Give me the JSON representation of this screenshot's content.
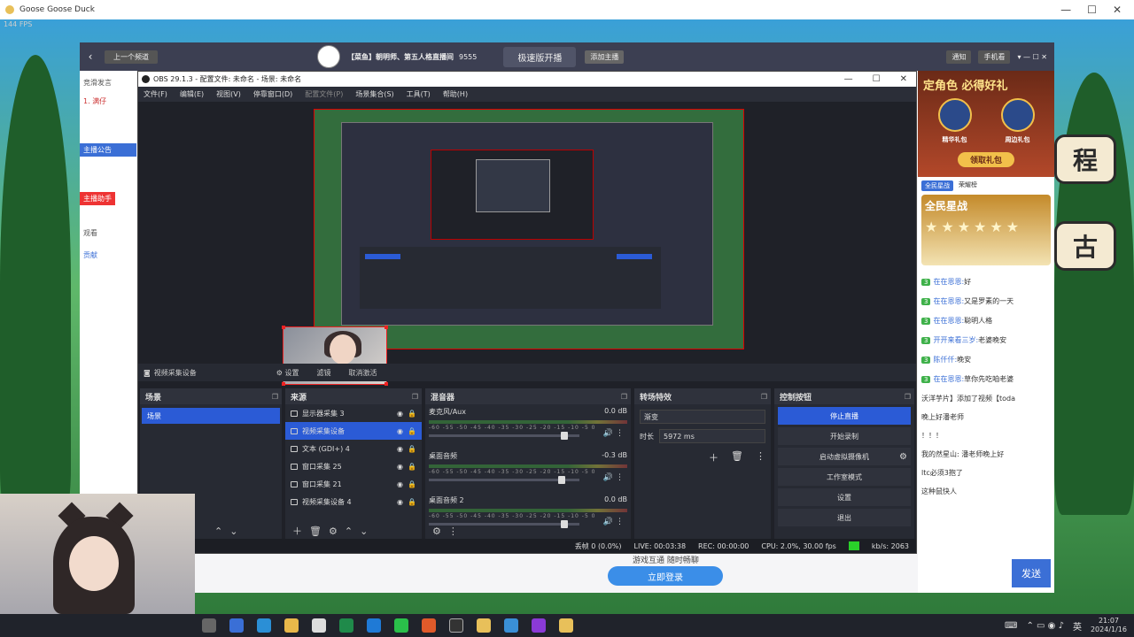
{
  "game": {
    "window_title": "Goose Goose Duck",
    "fps": "144 FPS",
    "controls": [
      "—",
      "☐",
      "✕"
    ]
  },
  "stream_app": {
    "back": "‹",
    "prev_label": "上一个频道",
    "channel_title": "【菜鱼】朝明师、第五人格直播间",
    "viewer_count": "9555",
    "fast_start": "极速版开播",
    "add_host": "添加主播",
    "notify": "通知",
    "phone": "手机看",
    "left_labels": [
      "竞滑发言",
      "1. 满仔",
      "主播公告",
      "主播助手",
      "观看",
      "贡献"
    ],
    "promo_title": "定角色 必得好礼",
    "promo_gifts": [
      "精华礼包",
      "周边礼包"
    ],
    "claim": "领取礼包",
    "tabs": [
      "全民星战",
      "荣耀榜"
    ],
    "stars_title": "全民星战",
    "stars_row": "★★★★★★",
    "chat": [
      {
        "lv": "3",
        "name": "在在恩恩:",
        "msg": "好"
      },
      {
        "lv": "3",
        "name": "在在恩恩:",
        "msg": "又是罗素的一天"
      },
      {
        "lv": "3",
        "name": "在在恩恩:",
        "msg": "聪明人格"
      },
      {
        "lv": "3",
        "name": "开开来看三岁:",
        "msg": "老婆晚安"
      },
      {
        "lv": "3",
        "name": "陈仟仟:",
        "msg": "晚安"
      },
      {
        "lv": "3",
        "name": "在在恩恩:",
        "msg": "草你先吃咱老婆"
      },
      {
        "lv": "",
        "name": "",
        "msg": "沃洋芋片】添加了视频【toda"
      },
      {
        "lv": "",
        "name": "",
        "msg": "晚上好潘老师"
      },
      {
        "lv": "",
        "name": "",
        "msg": "！！！"
      },
      {
        "lv": "",
        "name": "",
        "msg": "我的然星山: 潘老师晚上好"
      },
      {
        "lv": "",
        "name": "",
        "msg": "ltc必须3抱了"
      },
      {
        "lv": "",
        "name": "",
        "msg": "这种鼠快人"
      }
    ],
    "send": "发送",
    "game_slogan": "游戏互通 随时畅聊",
    "go_live": "立即登录"
  },
  "obs": {
    "title": "OBS 29.1.3 - 配置文件: 未命名 - 场景: 未命名",
    "menu": [
      "文件(F)",
      "编辑(E)",
      "视图(V)",
      "停靠窗口(D)",
      "配置文件(P)",
      "场景集合(S)",
      "工具(T)",
      "帮助(H)"
    ],
    "source_toolbar": {
      "selected": "视频采集设备",
      "settings": "⚙ 设置",
      "filters": "滤镜",
      "deactivate": "取消激活"
    },
    "scenes_title": "场景",
    "scenes": [
      "场景"
    ],
    "sources_title": "来源",
    "sources": [
      "显示器采集 3",
      "视频采集设备",
      "文本 (GDI+) 4",
      "窗口采集 25",
      "窗口采集 21",
      "视频采集设备 4"
    ],
    "mixer_title": "混音器",
    "mixer": [
      {
        "name": "麦克风/Aux",
        "db": "0.0 dB",
        "level": 0.92
      },
      {
        "name": "桌面音频",
        "db": "-0.3 dB",
        "level": 0.9
      },
      {
        "name": "桌面音频 2",
        "db": "0.0 dB",
        "level": 0.92
      }
    ],
    "mixer_ticks": "-60 -55 -50 -45 -40 -35 -30 -25 -20 -15 -10 -5 0",
    "transitions_title": "转场特效",
    "transition": "渐变",
    "duration_label": "时长",
    "duration": "5972 ms",
    "controls_title": "控制按钮",
    "controls": [
      "停止直播",
      "开始录制",
      "启动虚拟摄像机",
      "工作室模式",
      "设置",
      "退出"
    ],
    "status": {
      "dropped": "丢帧 0 (0.0%)",
      "live": "LIVE: 00:03:38",
      "rec": "REC: 00:00:00",
      "cpu": "CPU: 2.0%, 30.00 fps",
      "kbps": "kb/s: 2063"
    }
  },
  "taskbar": {
    "lang": "英",
    "time": "21:07",
    "date": "2024/1/16"
  }
}
